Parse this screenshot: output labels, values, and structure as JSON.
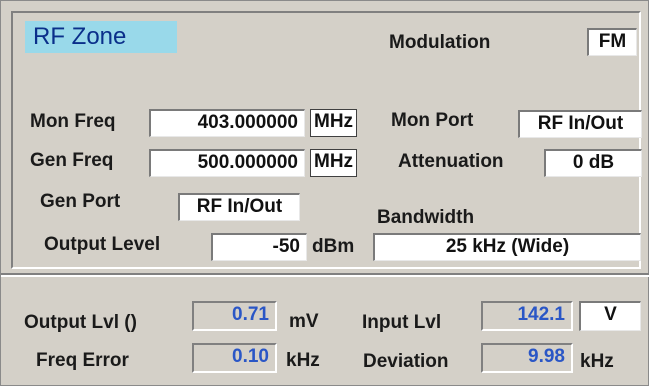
{
  "title": "RF Zone",
  "modulation": {
    "label": "Modulation",
    "value": "FM"
  },
  "mon_freq": {
    "label": "Mon Freq",
    "value": "403.000000",
    "unit": "MHz"
  },
  "gen_freq": {
    "label": "Gen Freq",
    "value": "500.000000",
    "unit": "MHz"
  },
  "mon_port": {
    "label": "Mon Port",
    "value": "RF In/Out"
  },
  "attenuation": {
    "label": "Attenuation",
    "value": "0 dB"
  },
  "gen_port": {
    "label": "Gen Port",
    "value": "RF In/Out"
  },
  "bandwidth": {
    "label": "Bandwidth",
    "value": "25 kHz (Wide)"
  },
  "output_level": {
    "label": "Output Level",
    "value": "-50",
    "unit": "dBm"
  },
  "readouts": {
    "output_lvl": {
      "label": "Output Lvl ()",
      "value": "0.71",
      "unit": "mV"
    },
    "input_lvl": {
      "label": "Input Lvl",
      "value": "142.1",
      "unit": "V"
    },
    "freq_error": {
      "label": "Freq Error",
      "value": "0.10",
      "unit": "kHz"
    },
    "deviation": {
      "label": "Deviation",
      "value": "9.98",
      "unit": "kHz"
    }
  },
  "colors": {
    "background": "#d4d0c8",
    "title_bg": "#99d9ea",
    "title_text": "#0a2f8a",
    "readout_text": "#2a56c6"
  }
}
